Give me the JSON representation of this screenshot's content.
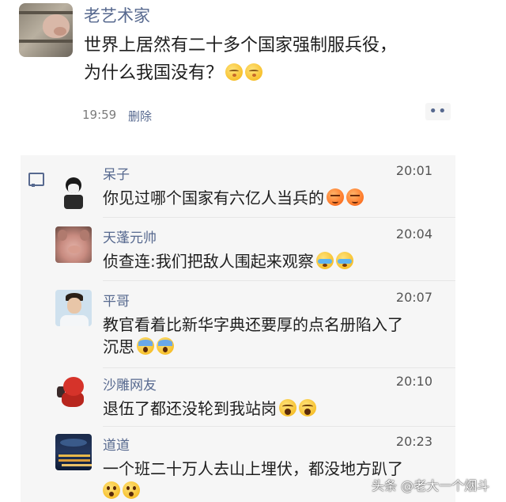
{
  "post": {
    "author": "老艺术家",
    "text_line1": "世界上居然有二十多个国家强制服兵役，",
    "text_line2": "为什么我国没有？",
    "emojis": [
      "kiss",
      "kiss"
    ],
    "time": "19:59",
    "delete_label": "删除",
    "more_label": "••"
  },
  "comments": [
    {
      "name": "呆子",
      "time": "20:01",
      "text": "你见过哪个国家有六亿人当兵的",
      "emojis": [
        "angry",
        "angry"
      ],
      "avatar": "daizi"
    },
    {
      "name": "天蓬元帅",
      "time": "20:04",
      "text": "侦查连:我们把敌人围起来观察",
      "emojis": [
        "cry",
        "cry"
      ],
      "avatar": "pig"
    },
    {
      "name": "平哥",
      "time": "20:07",
      "text_line1": "教官看着比新华字典还要厚的点名册陷入了",
      "text_line2": "沉思",
      "emojis": [
        "scream",
        "scream"
      ],
      "avatar": "man"
    },
    {
      "name": "沙雕网友",
      "time": "20:10",
      "text": "退伍了都还没轮到我站岗",
      "emojis": [
        "sob",
        "sob"
      ],
      "avatar": "red"
    },
    {
      "name": "道道",
      "time": "20:23",
      "text_line1": "一个班二十万人去山上埋伏，都没地方趴了",
      "emojis": [
        "wow",
        "wow"
      ],
      "avatar": "city"
    }
  ],
  "watermark": "头条 @老大一个烟斗"
}
